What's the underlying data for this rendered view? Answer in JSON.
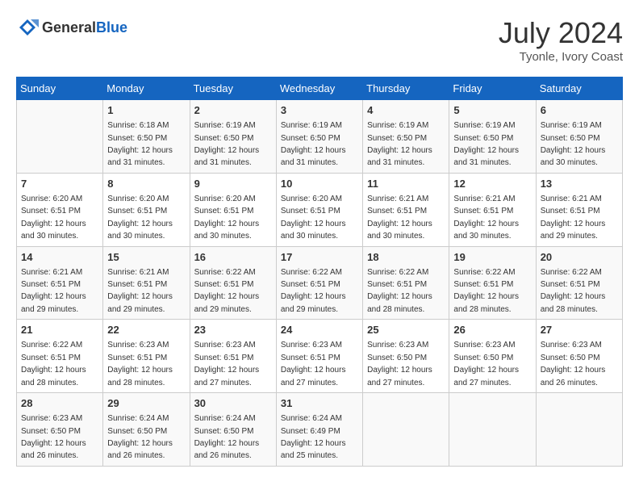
{
  "header": {
    "logo_general": "General",
    "logo_blue": "Blue",
    "month_year": "July 2024",
    "location": "Tyonle, Ivory Coast"
  },
  "calendar": {
    "days_of_week": [
      "Sunday",
      "Monday",
      "Tuesday",
      "Wednesday",
      "Thursday",
      "Friday",
      "Saturday"
    ],
    "weeks": [
      [
        {
          "day": "",
          "info": ""
        },
        {
          "day": "1",
          "info": "Sunrise: 6:18 AM\nSunset: 6:50 PM\nDaylight: 12 hours\nand 31 minutes."
        },
        {
          "day": "2",
          "info": "Sunrise: 6:19 AM\nSunset: 6:50 PM\nDaylight: 12 hours\nand 31 minutes."
        },
        {
          "day": "3",
          "info": "Sunrise: 6:19 AM\nSunset: 6:50 PM\nDaylight: 12 hours\nand 31 minutes."
        },
        {
          "day": "4",
          "info": "Sunrise: 6:19 AM\nSunset: 6:50 PM\nDaylight: 12 hours\nand 31 minutes."
        },
        {
          "day": "5",
          "info": "Sunrise: 6:19 AM\nSunset: 6:50 PM\nDaylight: 12 hours\nand 31 minutes."
        },
        {
          "day": "6",
          "info": "Sunrise: 6:19 AM\nSunset: 6:50 PM\nDaylight: 12 hours\nand 30 minutes."
        }
      ],
      [
        {
          "day": "7",
          "info": "Sunrise: 6:20 AM\nSunset: 6:51 PM\nDaylight: 12 hours\nand 30 minutes."
        },
        {
          "day": "8",
          "info": "Sunrise: 6:20 AM\nSunset: 6:51 PM\nDaylight: 12 hours\nand 30 minutes."
        },
        {
          "day": "9",
          "info": "Sunrise: 6:20 AM\nSunset: 6:51 PM\nDaylight: 12 hours\nand 30 minutes."
        },
        {
          "day": "10",
          "info": "Sunrise: 6:20 AM\nSunset: 6:51 PM\nDaylight: 12 hours\nand 30 minutes."
        },
        {
          "day": "11",
          "info": "Sunrise: 6:21 AM\nSunset: 6:51 PM\nDaylight: 12 hours\nand 30 minutes."
        },
        {
          "day": "12",
          "info": "Sunrise: 6:21 AM\nSunset: 6:51 PM\nDaylight: 12 hours\nand 30 minutes."
        },
        {
          "day": "13",
          "info": "Sunrise: 6:21 AM\nSunset: 6:51 PM\nDaylight: 12 hours\nand 29 minutes."
        }
      ],
      [
        {
          "day": "14",
          "info": "Sunrise: 6:21 AM\nSunset: 6:51 PM\nDaylight: 12 hours\nand 29 minutes."
        },
        {
          "day": "15",
          "info": "Sunrise: 6:21 AM\nSunset: 6:51 PM\nDaylight: 12 hours\nand 29 minutes."
        },
        {
          "day": "16",
          "info": "Sunrise: 6:22 AM\nSunset: 6:51 PM\nDaylight: 12 hours\nand 29 minutes."
        },
        {
          "day": "17",
          "info": "Sunrise: 6:22 AM\nSunset: 6:51 PM\nDaylight: 12 hours\nand 29 minutes."
        },
        {
          "day": "18",
          "info": "Sunrise: 6:22 AM\nSunset: 6:51 PM\nDaylight: 12 hours\nand 28 minutes."
        },
        {
          "day": "19",
          "info": "Sunrise: 6:22 AM\nSunset: 6:51 PM\nDaylight: 12 hours\nand 28 minutes."
        },
        {
          "day": "20",
          "info": "Sunrise: 6:22 AM\nSunset: 6:51 PM\nDaylight: 12 hours\nand 28 minutes."
        }
      ],
      [
        {
          "day": "21",
          "info": "Sunrise: 6:22 AM\nSunset: 6:51 PM\nDaylight: 12 hours\nand 28 minutes."
        },
        {
          "day": "22",
          "info": "Sunrise: 6:23 AM\nSunset: 6:51 PM\nDaylight: 12 hours\nand 28 minutes."
        },
        {
          "day": "23",
          "info": "Sunrise: 6:23 AM\nSunset: 6:51 PM\nDaylight: 12 hours\nand 27 minutes."
        },
        {
          "day": "24",
          "info": "Sunrise: 6:23 AM\nSunset: 6:51 PM\nDaylight: 12 hours\nand 27 minutes."
        },
        {
          "day": "25",
          "info": "Sunrise: 6:23 AM\nSunset: 6:50 PM\nDaylight: 12 hours\nand 27 minutes."
        },
        {
          "day": "26",
          "info": "Sunrise: 6:23 AM\nSunset: 6:50 PM\nDaylight: 12 hours\nand 27 minutes."
        },
        {
          "day": "27",
          "info": "Sunrise: 6:23 AM\nSunset: 6:50 PM\nDaylight: 12 hours\nand 26 minutes."
        }
      ],
      [
        {
          "day": "28",
          "info": "Sunrise: 6:23 AM\nSunset: 6:50 PM\nDaylight: 12 hours\nand 26 minutes."
        },
        {
          "day": "29",
          "info": "Sunrise: 6:24 AM\nSunset: 6:50 PM\nDaylight: 12 hours\nand 26 minutes."
        },
        {
          "day": "30",
          "info": "Sunrise: 6:24 AM\nSunset: 6:50 PM\nDaylight: 12 hours\nand 26 minutes."
        },
        {
          "day": "31",
          "info": "Sunrise: 6:24 AM\nSunset: 6:49 PM\nDaylight: 12 hours\nand 25 minutes."
        },
        {
          "day": "",
          "info": ""
        },
        {
          "day": "",
          "info": ""
        },
        {
          "day": "",
          "info": ""
        }
      ]
    ]
  }
}
